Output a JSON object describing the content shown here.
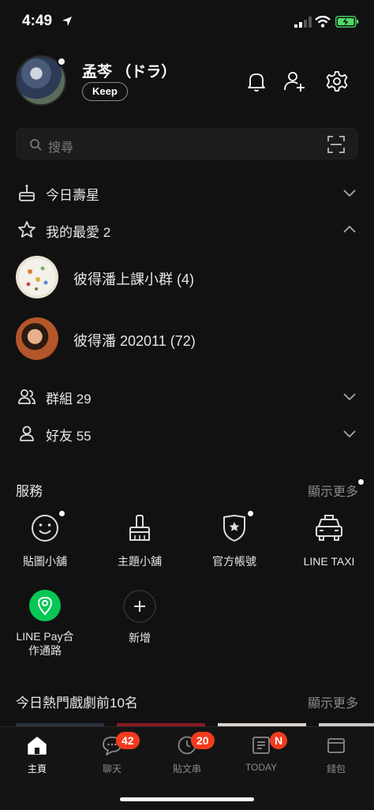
{
  "status": {
    "time": "4:49"
  },
  "profile": {
    "name": "孟芩 （ドラ）",
    "keep_label": "Keep"
  },
  "search": {
    "placeholder": "搜尋"
  },
  "rows": {
    "birthday": "今日壽星",
    "favorites": "我的最愛 2",
    "groups": "群組 29",
    "friends": "好友 55"
  },
  "favorites": [
    {
      "name": "彼得潘上課小群  (4)"
    },
    {
      "name": "彼得潘 202011  (72)"
    }
  ],
  "services": {
    "title": "服務",
    "show_more": "顯示更多",
    "items": [
      {
        "label": "貼圖小舖",
        "icon": "smiley-icon"
      },
      {
        "label": "主題小舖",
        "icon": "brush-icon"
      },
      {
        "label": "官方帳號",
        "icon": "shield-star-icon"
      },
      {
        "label": "LINE TAXI",
        "icon": "taxi-icon"
      },
      {
        "label": "LINE Pay合\n作通路",
        "icon": "location-pin-icon"
      },
      {
        "label": "新增",
        "icon": "plus-icon"
      }
    ]
  },
  "trending": {
    "title": "今日熱門戲劇前10名",
    "show_more": "顯示更多"
  },
  "tabs": [
    {
      "label": "主頁",
      "icon": "home-icon",
      "badge": ""
    },
    {
      "label": "聊天",
      "icon": "chat-icon",
      "badge": "42"
    },
    {
      "label": "貼文串",
      "icon": "clock-icon",
      "badge": "20"
    },
    {
      "label": "TODAY",
      "icon": "news-icon",
      "badge": "N"
    },
    {
      "label": "錢包",
      "icon": "wallet-icon",
      "badge": ""
    }
  ],
  "colors": {
    "background": "#111111",
    "badge": "#f23a1d",
    "line_green": "#06c755",
    "battery_green": "#4cd964"
  }
}
